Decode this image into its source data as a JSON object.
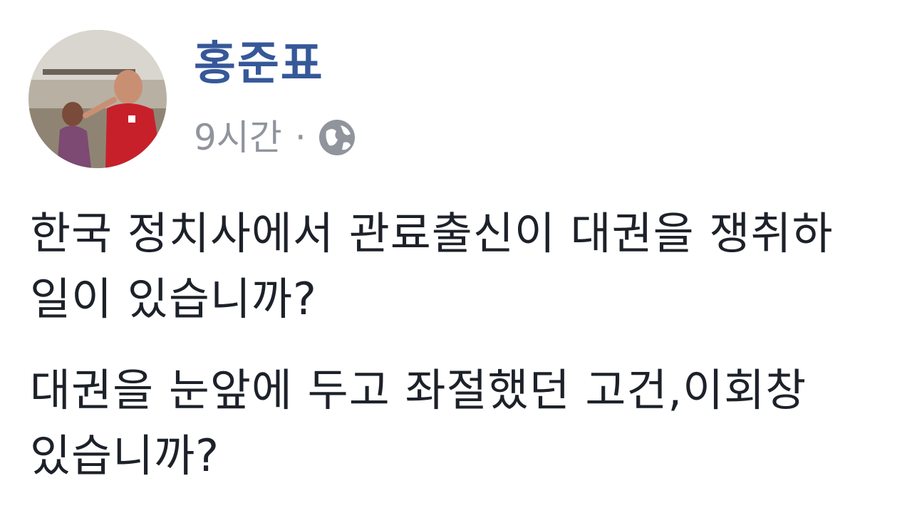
{
  "post": {
    "author": "홍준표",
    "timestamp": "9시간",
    "separator": "·",
    "privacy_icon": "globe-icon",
    "paragraphs": [
      {
        "lines": [
          "한국 정치사에서 관료출신이 대권을 쟁취하",
          "일이 있습니까?"
        ]
      },
      {
        "lines": [
          "대권을 눈앞에 두고 좌절했던 고건,이회창",
          "있습니까?"
        ]
      }
    ]
  },
  "colors": {
    "author_link": "#365899",
    "meta_text": "#90949c",
    "body_text": "#1d2129"
  }
}
